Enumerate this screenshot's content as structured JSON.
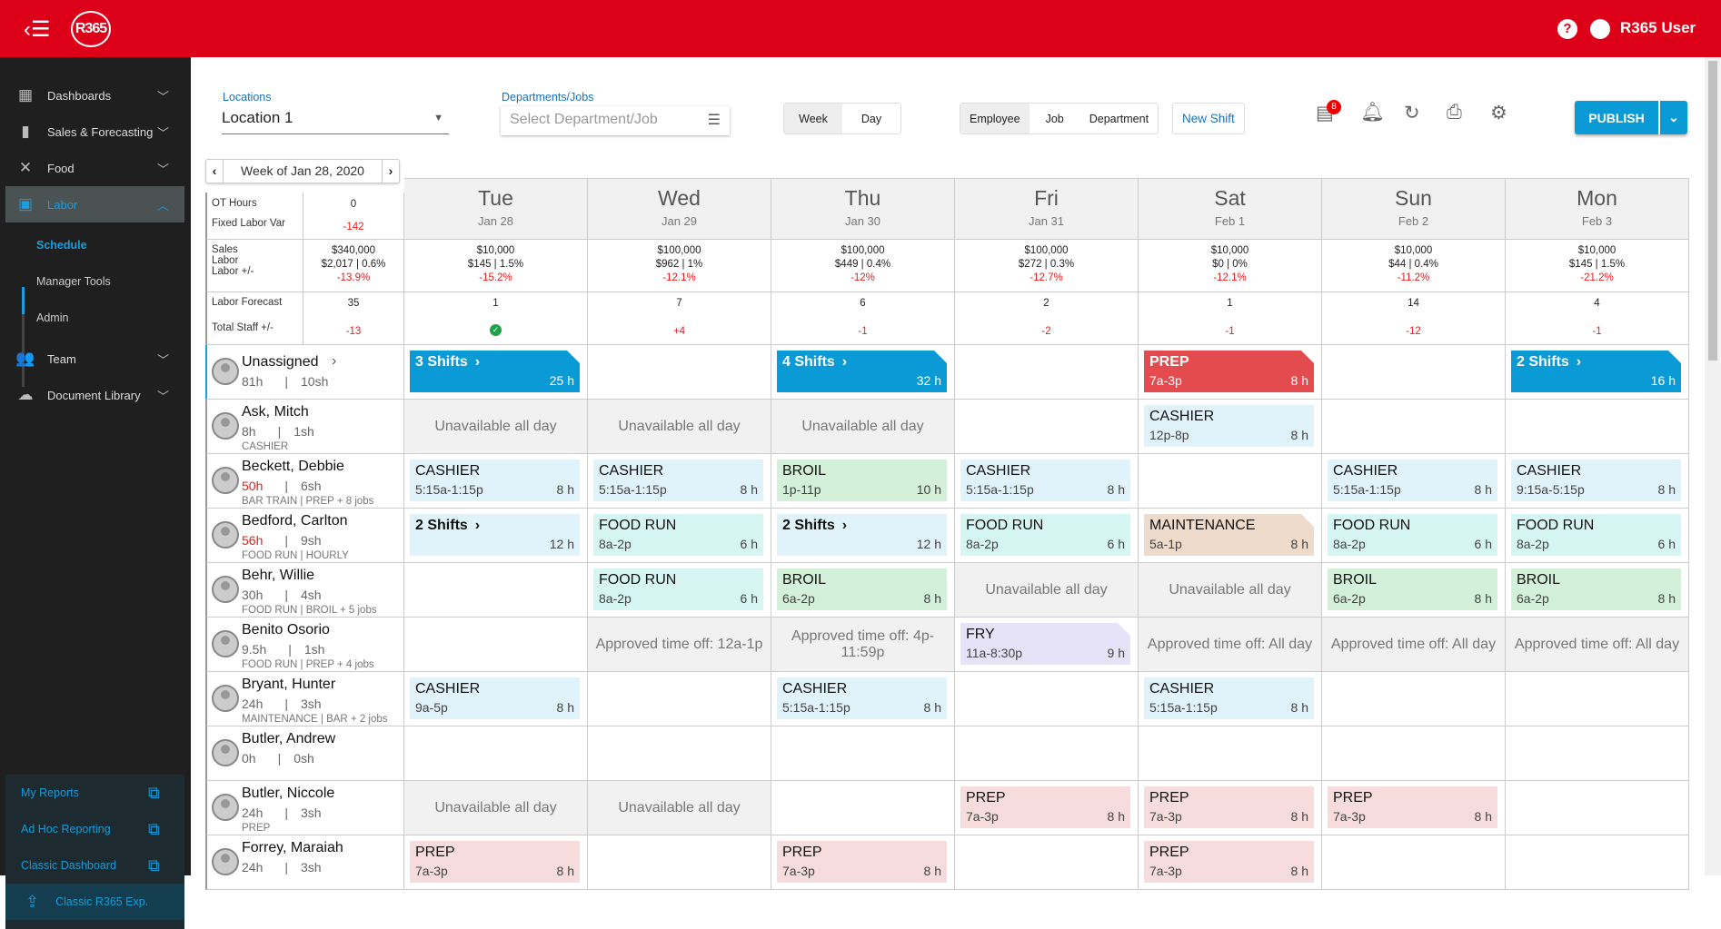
{
  "header": {
    "logo": "R365",
    "user": "R365 User",
    "help_icon": "help-icon",
    "user_icon": "account-icon"
  },
  "sidebar": {
    "items": [
      {
        "label": "Dashboards",
        "icon": "dashboard-icon",
        "glyph": "▦"
      },
      {
        "label": "Sales & Forecasting",
        "icon": "bar-chart-icon",
        "glyph": "▮"
      },
      {
        "label": "Food",
        "icon": "utensils-icon",
        "glyph": "✕"
      },
      {
        "label": "Labor",
        "icon": "calendar-icon",
        "glyph": "▣",
        "active": true
      },
      {
        "label": "Team",
        "icon": "people-icon",
        "glyph": "👥"
      },
      {
        "label": "Document Library",
        "icon": "cloud-icon",
        "glyph": "☁"
      }
    ],
    "labor_sub": [
      "Schedule",
      "Manager Tools",
      "Admin"
    ],
    "links": [
      "My Reports",
      "Ad Hoc Reporting",
      "Classic Dashboard"
    ],
    "classic": "Classic R365 Exp."
  },
  "toolbar": {
    "locations_label": "Locations",
    "location": "Location 1",
    "departments_label": "Departments/Jobs",
    "departments_placeholder": "Select Department/Job",
    "view": [
      "Week",
      "Day"
    ],
    "group": [
      "Employee",
      "Job",
      "Department"
    ],
    "new_shift": "New Shift",
    "messages_count": "8",
    "publish": "PUBLISH"
  },
  "week": {
    "label": "Week of Jan 28, 2020"
  },
  "summary": {
    "ot_label": "OT Hours",
    "ot": "0",
    "fixed_label": "Fixed Labor Var",
    "fixed": "-142",
    "sales_label": "Sales",
    "labor_label": "Labor",
    "laborpm_label": "Labor +/-",
    "sales": "$340,000",
    "labor": "$2,017 | 0.6%",
    "laborpm": "-13.9%",
    "forecast_label": "Labor Forecast",
    "forecast": "35",
    "staff_label": "Total Staff +/-",
    "staff": "-13"
  },
  "days": [
    {
      "name": "Tue",
      "date": "Jan 28",
      "sales": "$10,000",
      "labor": "$145 | 1.5%",
      "laborpm": "-15.2%",
      "forecast": "1",
      "staff": "ok"
    },
    {
      "name": "Wed",
      "date": "Jan 29",
      "sales": "$100,000",
      "labor": "$962 | 1%",
      "laborpm": "-12.1%",
      "forecast": "7",
      "staff": "+4"
    },
    {
      "name": "Thu",
      "date": "Jan 30",
      "sales": "$100,000",
      "labor": "$449 | 0.4%",
      "laborpm": "-12%",
      "forecast": "6",
      "staff": "-1"
    },
    {
      "name": "Fri",
      "date": "Jan 31",
      "sales": "$100,000",
      "labor": "$272 | 0.3%",
      "laborpm": "-12.7%",
      "forecast": "2",
      "staff": "-2"
    },
    {
      "name": "Sat",
      "date": "Feb 1",
      "sales": "$10,000",
      "labor": "$0 | 0%",
      "laborpm": "-12.1%",
      "forecast": "1",
      "staff": "-1"
    },
    {
      "name": "Sun",
      "date": "Feb 2",
      "sales": "$10,000",
      "labor": "$44 | 0.4%",
      "laborpm": "-11.2%",
      "forecast": "14",
      "staff": "-12"
    },
    {
      "name": "Mon",
      "date": "Feb 3",
      "sales": "$10,000",
      "labor": "$145 | 1.5%",
      "laborpm": "-21.2%",
      "forecast": "4",
      "staff": "-1"
    }
  ],
  "colors": {
    "CASHIER": "#e1f3fa",
    "FOOD RUN": "#d6f6f3",
    "BROIL": "#d3f0d8",
    "PREP": "#f6dcdc",
    "MAINTENANCE": "#eedbcb",
    "FRY": "#e6e2f8",
    "multi": "#e1f3fa",
    "blue": "#0a9ad6",
    "red": "#e34b4f"
  },
  "rows": [
    {
      "name": "Unassigned",
      "hours": "81h",
      "shifts": "10sh",
      "jobs": "",
      "unassigned": true,
      "cells": [
        {
          "t": "multi",
          "label": "3 Shifts",
          "hours": "25 h",
          "color": "blue",
          "corner": true
        },
        {
          "t": "e"
        },
        {
          "t": "multi",
          "label": "4 Shifts",
          "hours": "32 h",
          "color": "blue",
          "corner": true
        },
        {
          "t": "e"
        },
        {
          "t": "s",
          "job": "PREP",
          "time": "7a-3p",
          "hours": "8 h",
          "color": "red",
          "corner": true
        },
        {
          "t": "e"
        },
        {
          "t": "multi",
          "label": "2 Shifts",
          "hours": "16 h",
          "color": "blue",
          "corner": true
        }
      ]
    },
    {
      "name": "Ask, Mitch",
      "hours": "8h",
      "shifts": "1sh",
      "jobs": "CASHIER",
      "cells": [
        {
          "t": "g",
          "text": "Unavailable all day"
        },
        {
          "t": "g",
          "text": "Unavailable all day"
        },
        {
          "t": "g",
          "text": "Unavailable all day"
        },
        {
          "t": "e"
        },
        {
          "t": "s",
          "job": "CASHIER",
          "time": "12p-8p",
          "hours": "8 h"
        },
        {
          "t": "e"
        },
        {
          "t": "e"
        }
      ]
    },
    {
      "name": "Beckett, Debbie",
      "hours": "50h",
      "over": true,
      "shifts": "6sh",
      "jobs": "BAR TRAIN | PREP + 8 jobs",
      "cells": [
        {
          "t": "s",
          "job": "CASHIER",
          "time": "5:15a-1:15p",
          "hours": "8 h"
        },
        {
          "t": "s",
          "job": "CASHIER",
          "time": "5:15a-1:15p",
          "hours": "8 h"
        },
        {
          "t": "s",
          "job": "BROIL",
          "time": "1p-11p",
          "hours": "10 h"
        },
        {
          "t": "s",
          "job": "CASHIER",
          "time": "5:15a-1:15p",
          "hours": "8 h"
        },
        {
          "t": "e"
        },
        {
          "t": "s",
          "job": "CASHIER",
          "time": "5:15a-1:15p",
          "hours": "8 h"
        },
        {
          "t": "s",
          "job": "CASHIER",
          "time": "9:15a-5:15p",
          "hours": "8 h"
        }
      ]
    },
    {
      "name": "Bedford, Carlton",
      "hours": "56h",
      "over": true,
      "shifts": "9sh",
      "jobs": "FOOD RUN | HOURLY",
      "cells": [
        {
          "t": "multi",
          "label": "2 Shifts",
          "hours": "12 h",
          "color": "multi"
        },
        {
          "t": "s",
          "job": "FOOD RUN",
          "time": "8a-2p",
          "hours": "6 h"
        },
        {
          "t": "multi",
          "label": "2 Shifts",
          "hours": "12 h",
          "color": "multi"
        },
        {
          "t": "s",
          "job": "FOOD RUN",
          "time": "8a-2p",
          "hours": "6 h"
        },
        {
          "t": "s",
          "job": "MAINTENANCE",
          "time": "5a-1p",
          "hours": "8 h",
          "corner": true
        },
        {
          "t": "s",
          "job": "FOOD RUN",
          "time": "8a-2p",
          "hours": "6 h"
        },
        {
          "t": "s",
          "job": "FOOD RUN",
          "time": "8a-2p",
          "hours": "6 h"
        }
      ]
    },
    {
      "name": "Behr, Willie",
      "hours": "30h",
      "shifts": "4sh",
      "jobs": "FOOD RUN | BROIL + 5 jobs",
      "cells": [
        {
          "t": "e"
        },
        {
          "t": "s",
          "job": "FOOD RUN",
          "time": "8a-2p",
          "hours": "6 h"
        },
        {
          "t": "s",
          "job": "BROIL",
          "time": "6a-2p",
          "hours": "8 h"
        },
        {
          "t": "g",
          "text": "Unavailable all day"
        },
        {
          "t": "g",
          "text": "Unavailable all day"
        },
        {
          "t": "s",
          "job": "BROIL",
          "time": "6a-2p",
          "hours": "8 h"
        },
        {
          "t": "s",
          "job": "BROIL",
          "time": "6a-2p",
          "hours": "8 h"
        }
      ]
    },
    {
      "name": "Benito Osorio",
      "hours": "9.5h",
      "shifts": "1sh",
      "jobs": "FOOD RUN | PREP + 4 jobs",
      "cells": [
        {
          "t": "e"
        },
        {
          "t": "g",
          "text": "Approved time off: 12a-1p"
        },
        {
          "t": "g",
          "text": "Approved time off: 4p-11:59p"
        },
        {
          "t": "s",
          "job": "FRY",
          "time": "11a-8:30p",
          "hours": "9 h",
          "corner": true
        },
        {
          "t": "g",
          "text": "Approved time off: All day"
        },
        {
          "t": "g",
          "text": "Approved time off: All day"
        },
        {
          "t": "g",
          "text": "Approved time off: All day"
        }
      ]
    },
    {
      "name": "Bryant, Hunter",
      "hours": "24h",
      "shifts": "3sh",
      "jobs": "MAINTENANCE | BAR + 2 jobs",
      "cells": [
        {
          "t": "s",
          "job": "CASHIER",
          "time": "9a-5p",
          "hours": "8 h"
        },
        {
          "t": "e"
        },
        {
          "t": "s",
          "job": "CASHIER",
          "time": "5:15a-1:15p",
          "hours": "8 h"
        },
        {
          "t": "e"
        },
        {
          "t": "s",
          "job": "CASHIER",
          "time": "5:15a-1:15p",
          "hours": "8 h"
        },
        {
          "t": "e"
        },
        {
          "t": "e"
        }
      ]
    },
    {
      "name": "Butler, Andrew",
      "hours": "0h",
      "shifts": "0sh",
      "jobs": "",
      "cells": [
        {
          "t": "e"
        },
        {
          "t": "e"
        },
        {
          "t": "e"
        },
        {
          "t": "e"
        },
        {
          "t": "e"
        },
        {
          "t": "e"
        },
        {
          "t": "e"
        }
      ]
    },
    {
      "name": "Butler, Niccole",
      "hours": "24h",
      "shifts": "3sh",
      "jobs": "PREP",
      "cells": [
        {
          "t": "g",
          "text": "Unavailable all day"
        },
        {
          "t": "g",
          "text": "Unavailable all day"
        },
        {
          "t": "e"
        },
        {
          "t": "s",
          "job": "PREP",
          "time": "7a-3p",
          "hours": "8 h"
        },
        {
          "t": "s",
          "job": "PREP",
          "time": "7a-3p",
          "hours": "8 h"
        },
        {
          "t": "s",
          "job": "PREP",
          "time": "7a-3p",
          "hours": "8 h"
        },
        {
          "t": "e"
        }
      ]
    },
    {
      "name": "Forrey, Maraiah",
      "hours": "24h",
      "shifts": "3sh",
      "jobs": "",
      "cells": [
        {
          "t": "s",
          "job": "PREP",
          "time": "7a-3p",
          "hours": "8 h"
        },
        {
          "t": "e"
        },
        {
          "t": "s",
          "job": "PREP",
          "time": "7a-3p",
          "hours": "8 h"
        },
        {
          "t": "e"
        },
        {
          "t": "s",
          "job": "PREP",
          "time": "7a-3p",
          "hours": "8 h"
        },
        {
          "t": "e"
        },
        {
          "t": "e"
        }
      ]
    }
  ]
}
